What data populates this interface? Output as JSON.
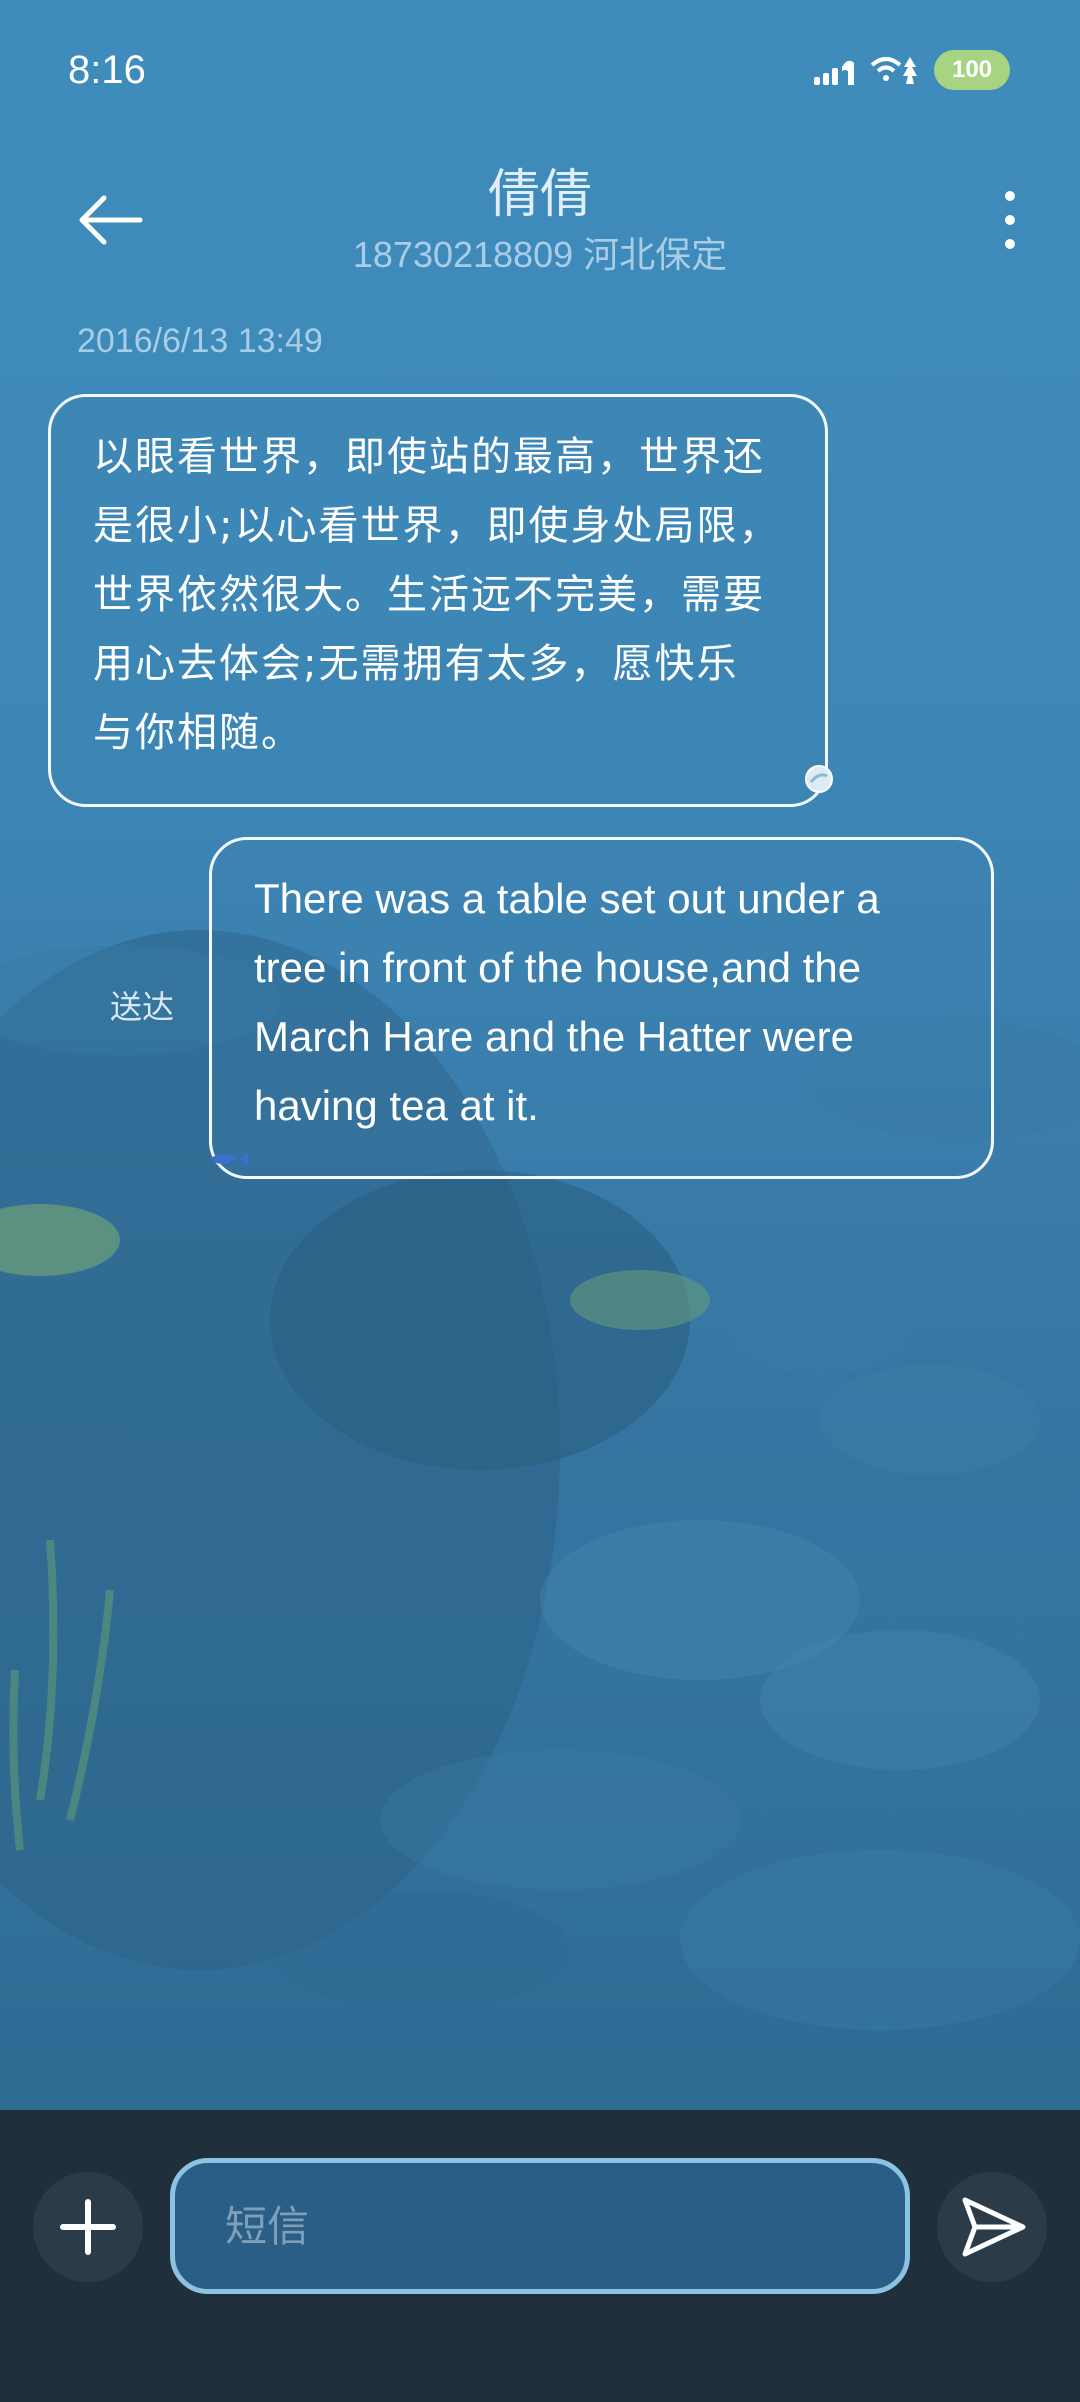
{
  "status_bar": {
    "time": "8:16",
    "battery": "100",
    "icons": [
      "signal-icon",
      "wifi-icon",
      "battery-icon"
    ]
  },
  "header": {
    "title": "倩倩",
    "subtitle": "18730218809 河北保定",
    "icons": [
      "back-arrow-icon",
      "more-vertical-icon"
    ]
  },
  "conversation": {
    "timestamp": "2016/6/13 13:49",
    "messages": [
      {
        "direction": "incoming",
        "lines": [
          "以眼看世界，即使站的最高，世界还",
          "是很小;以心看世界，即使身处局限，",
          "世界依然很大。生活远不完美，需要",
          "用心去体会;无需拥有太多，愿快乐",
          "与你相随。"
        ]
      },
      {
        "direction": "outgoing",
        "status": "送达",
        "lines": [
          "There was a table set out under a",
          "tree in front of the house,and the",
          "March Hare and the Hatter were",
          "having tea at it."
        ]
      }
    ]
  },
  "composer": {
    "placeholder": "短信",
    "value": "",
    "icons": [
      "plus-icon",
      "send-icon"
    ]
  },
  "colors": {
    "background": "#3d87b6",
    "bottom_bar": "#1f2f3c",
    "input_border": "#8cc2e2",
    "battery": "#a7d482"
  }
}
